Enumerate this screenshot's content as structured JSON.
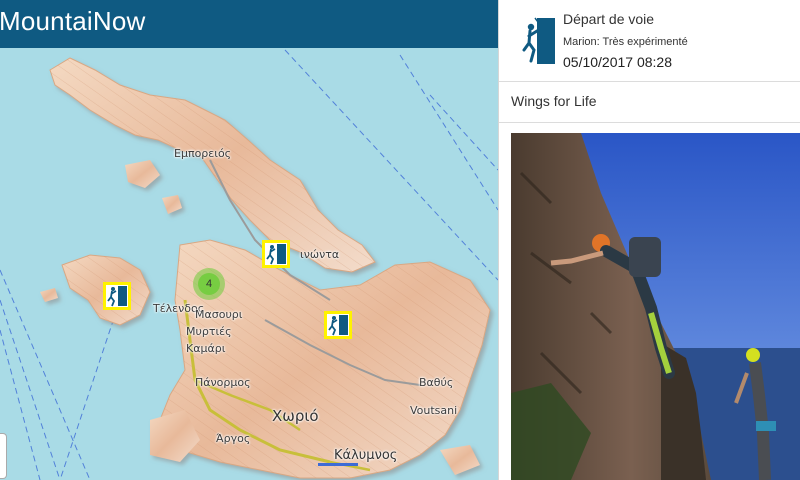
{
  "app": {
    "title": "MountaiNow"
  },
  "map": {
    "places": {
      "emporeios": "Εμπορειός",
      "arginonta": "ινώντα",
      "telendos": "Τέλενδος",
      "masouri": "Μασουρι",
      "myrties": "Μυρτιές",
      "kamari": "Καμάρι",
      "panormos": "Πάνορμος",
      "chorio": "Χωριό",
      "vathys": "Βαθύς",
      "voutsani": "Voutsani",
      "argos": "Άργος",
      "kalymnos": "Κάλυμνος"
    },
    "cluster_count": "4",
    "markers": [
      "climbing-icon",
      "climbing-icon",
      "climbing-icon"
    ],
    "colors": {
      "sea": "#a9dbe6",
      "marker_frame": "#fff200",
      "marker_icon": "#0f5a82",
      "cluster": "#6ecc39"
    }
  },
  "panel": {
    "event_type": "Départ de voie",
    "user_line": "Marion: Très expérimenté",
    "datetime": "05/10/2017 08:28",
    "route_name": "Wings for Life",
    "icon": "climbing-icon"
  },
  "colors": {
    "appbar": "#0f5a82"
  }
}
